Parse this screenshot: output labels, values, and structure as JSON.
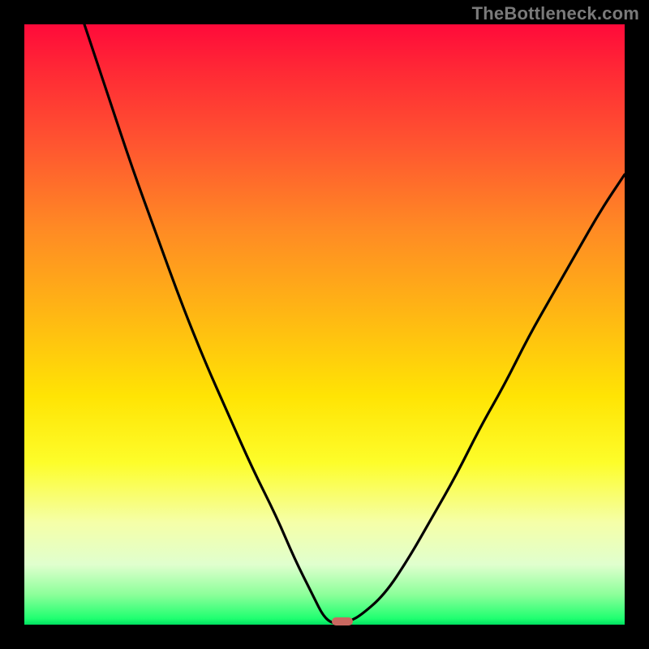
{
  "attribution": "TheBottleneck.com",
  "colors": {
    "frame": "#000000",
    "curve": "#000000",
    "marker": "#c96860",
    "gradient_top": "#ff0a3a",
    "gradient_bottom": "#00e060"
  },
  "chart_data": {
    "type": "line",
    "title": "",
    "xlabel": "",
    "ylabel": "",
    "xlim": [
      0,
      100
    ],
    "ylim": [
      0,
      100
    ],
    "grid": false,
    "legend": false,
    "x": [
      10,
      14,
      18,
      22,
      26,
      30,
      34,
      38,
      42,
      45,
      48,
      50,
      52,
      54,
      56,
      60,
      64,
      68,
      72,
      76,
      80,
      84,
      88,
      92,
      96,
      100
    ],
    "y": [
      100,
      88,
      76,
      65,
      54,
      44,
      35,
      26,
      18,
      11,
      5,
      1,
      0,
      0.5,
      1.5,
      5,
      11,
      18,
      25,
      33,
      40,
      48,
      55,
      62,
      69,
      75
    ],
    "minimum": {
      "x": 53,
      "y": 0
    },
    "annotations": []
  }
}
